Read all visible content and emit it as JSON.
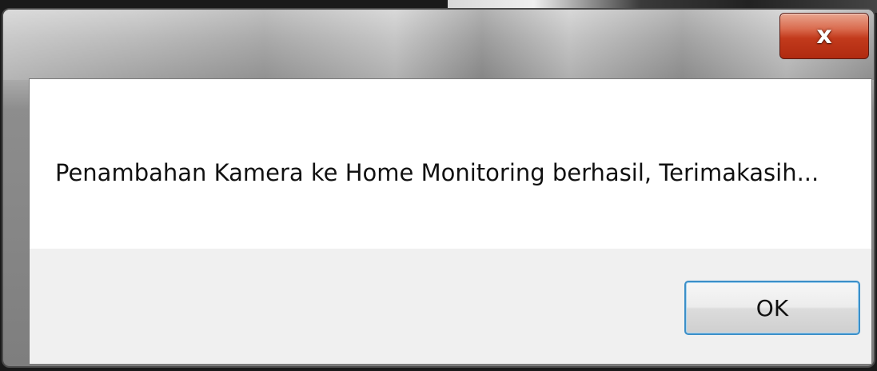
{
  "dialog": {
    "close_label": "x",
    "message": "Penambahan Kamera ke Home Monitoring berhasil, Terimakasih...",
    "ok_label": "OK"
  }
}
